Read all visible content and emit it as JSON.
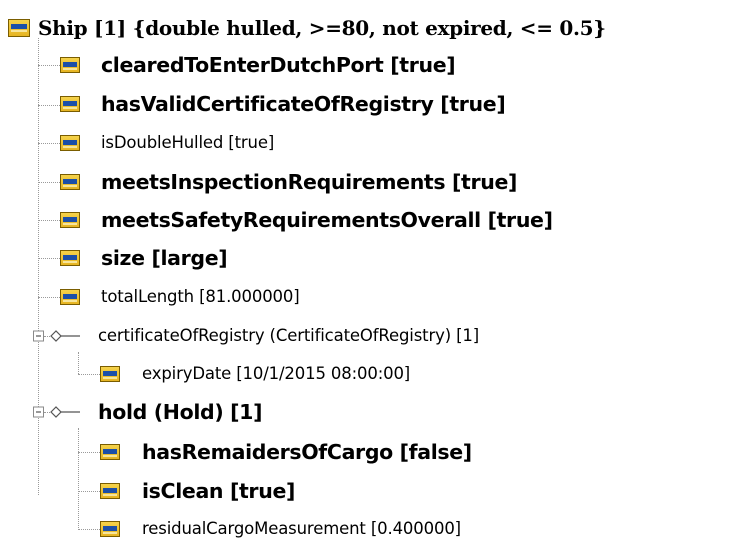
{
  "tree": {
    "root": {
      "label": "Ship [1] {double hulled, >=80, not expired, <= 0.5}",
      "icon": "attribute-icon"
    },
    "ship_attributes": [
      {
        "label": "clearedToEnterDutchPort [true]"
      },
      {
        "label": "hasValidCertificateOfRegistry [true]"
      },
      {
        "label": "isDoubleHulled [true]"
      },
      {
        "label": "meetsInspectionRequirements [true]"
      },
      {
        "label": "meetsSafetyRequirementsOverall [true]"
      },
      {
        "label": "size [large]"
      },
      {
        "label": "totalLength [81.000000]"
      }
    ],
    "certificate_node": {
      "label": "certificateOfRegistry (CertificateOfRegistry) [1]",
      "expander": "collapse",
      "children": [
        {
          "label": "expiryDate [10/1/2015 08:00:00]"
        }
      ]
    },
    "hold_node": {
      "label": "hold (Hold) [1]",
      "expander": "collapse",
      "children": [
        {
          "label": "hasRemaidersOfCargo [false]"
        },
        {
          "label": "isClean [true]"
        },
        {
          "label": "residualCargoMeasurement [0.400000]"
        }
      ]
    }
  },
  "colors": {
    "icon_fill": "#e6b422",
    "icon_band": "#1b4fa8",
    "tree_lines": "#9a9a9a",
    "text": "#000000",
    "background": "#ffffff"
  }
}
